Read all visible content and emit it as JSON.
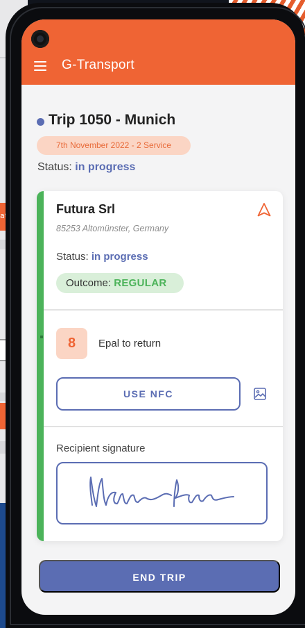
{
  "app": {
    "title": "G-Transport"
  },
  "trip": {
    "title": "Trip 1050 - Munich",
    "date_badge": "7th November 2022 - 2 Service",
    "status_label": "Status:",
    "status_value": "in progress"
  },
  "card": {
    "company": "Futura Srl",
    "address": "85253 Altomünster, Germany",
    "status_label": "Status:",
    "status_value": "in progress",
    "outcome_label": "Outcome:",
    "outcome_value": "REGULAR",
    "item": {
      "quantity": "8",
      "label": "Epal to return"
    },
    "nfc_button": "USE NFC",
    "signature_label": "Recipient signature"
  },
  "end_button": "END TRIP",
  "colors": {
    "brand": "#ef6434",
    "accent": "#5b6db3",
    "success": "#4cb35a",
    "background": "#f4f4f5"
  },
  "icons": {
    "menu": "menu-icon",
    "navigate": "navigation-arrow-icon",
    "image": "image-icon",
    "camera": "camera-lens"
  },
  "background_fragment": {
    "text": "ati"
  }
}
